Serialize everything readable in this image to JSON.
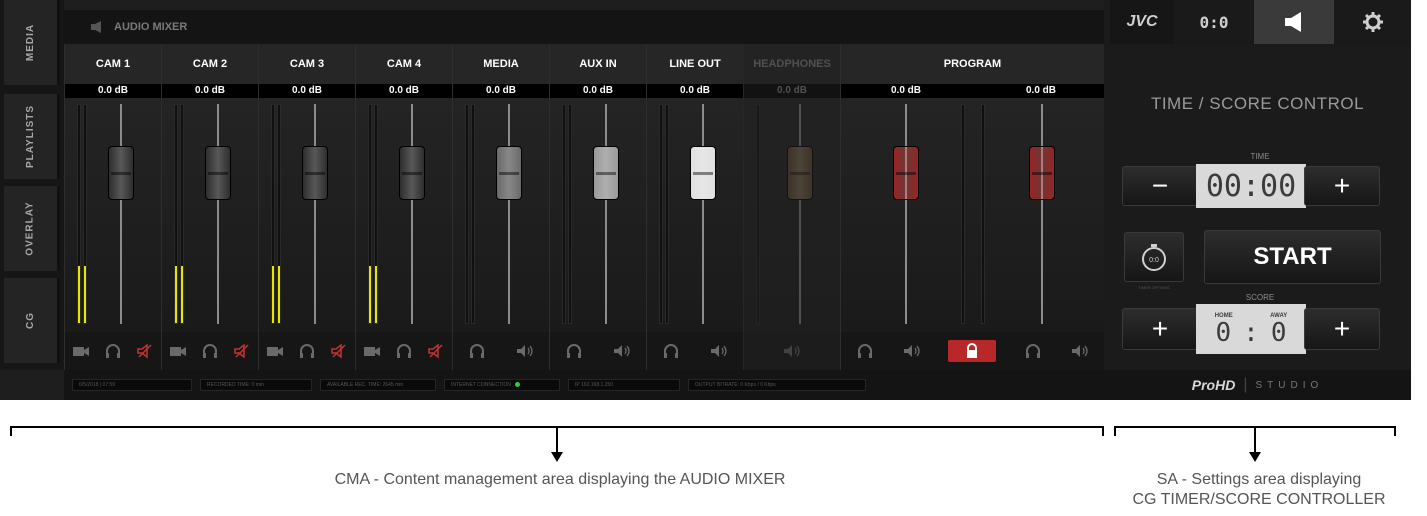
{
  "nav": {
    "tabs": [
      {
        "label": "MEDIA"
      },
      {
        "label": "PLAYLISTS"
      },
      {
        "label": "OVERLAY"
      },
      {
        "label": "CG"
      }
    ]
  },
  "mixer": {
    "title": "AUDIO MIXER",
    "channels": [
      {
        "name": "CAM 1",
        "db": "0.0 dB",
        "knob_color": "#2e2e2e",
        "meter_level": 0.26,
        "footer_icons": [
          "camera-icon",
          "headphones-icon",
          "speaker-muted-icon"
        ]
      },
      {
        "name": "CAM 2",
        "db": "0.0 dB",
        "knob_color": "#2e2e2e",
        "meter_level": 0.26,
        "footer_icons": [
          "camera-icon",
          "headphones-icon",
          "speaker-muted-icon"
        ]
      },
      {
        "name": "CAM 3",
        "db": "0.0 dB",
        "knob_color": "#2e2e2e",
        "meter_level": 0.26,
        "footer_icons": [
          "camera-icon",
          "headphones-icon",
          "speaker-muted-icon"
        ]
      },
      {
        "name": "CAM 4",
        "db": "0.0 dB",
        "knob_color": "#2e2e2e",
        "meter_level": 0.26,
        "footer_icons": [
          "camera-icon",
          "headphones-icon",
          "speaker-muted-icon"
        ]
      },
      {
        "name": "MEDIA",
        "db": "0.0 dB",
        "knob_color": "#6a6a6a",
        "meter_level": 0,
        "footer_icons": [
          "headphones-icon",
          "speaker-icon"
        ]
      },
      {
        "name": "AUX IN",
        "db": "0.0 dB",
        "knob_color": "#9a9a9a",
        "meter_level": 0,
        "footer_icons": [
          "headphones-icon",
          "speaker-icon"
        ]
      },
      {
        "name": "LINE OUT",
        "db": "0.0 dB",
        "knob_color": "#e0e0e0",
        "meter_level": 0,
        "footer_icons": [
          "headphones-icon",
          "speaker-icon"
        ]
      },
      {
        "name": "HEADPHONES",
        "db": "0.0 dB",
        "knob_color": "#5e4a2a",
        "meter_level": 0,
        "footer_icons": [
          "speaker-icon"
        ],
        "dimmed": true
      }
    ],
    "program": {
      "name": "PROGRAM",
      "db_left": "0.0 dB",
      "db_right": "0.0 dB",
      "knob_color": "#9a2323",
      "footer_icons": [
        "headphones-icon",
        "speaker-icon",
        "lock-icon",
        "headphones-icon",
        "speaker-icon"
      ]
    }
  },
  "status": {
    "items": [
      "6/5/2018 | 07:59",
      "RECORDED TIME: 0 min",
      "AVAILABLE REC. TIME: 2645 min",
      "INTERNET CONNECTION",
      "IP    192.168.1.250",
      "OUTPUT BITRATE:  0 Kbps / 0 Kbps"
    ]
  },
  "settings": {
    "brand": "JVC",
    "score_tab": "0:0",
    "panel_title": "TIME / SCORE CONTROL",
    "time_label": "TIME",
    "time_value": "00:00",
    "time_minus": "−",
    "time_plus": "+",
    "start_label": "START",
    "timer_options_label": "TIMER OPTIONS",
    "score_label": "SCORE",
    "home_label": "HOME",
    "away_label": "AWAY",
    "score_home": "0",
    "score_sep": ":",
    "score_away": "0",
    "score_plus_left": "+",
    "score_plus_right": "+",
    "footer_brand": "ProHD",
    "footer_brand_suffix": "STUDIO"
  },
  "annotations": {
    "left_caption": "CMA - Content management area displaying the AUDIO MIXER",
    "right_caption_line1": "SA - Settings area displaying",
    "right_caption_line2": "CG TIMER/SCORE CONTROLLER"
  }
}
